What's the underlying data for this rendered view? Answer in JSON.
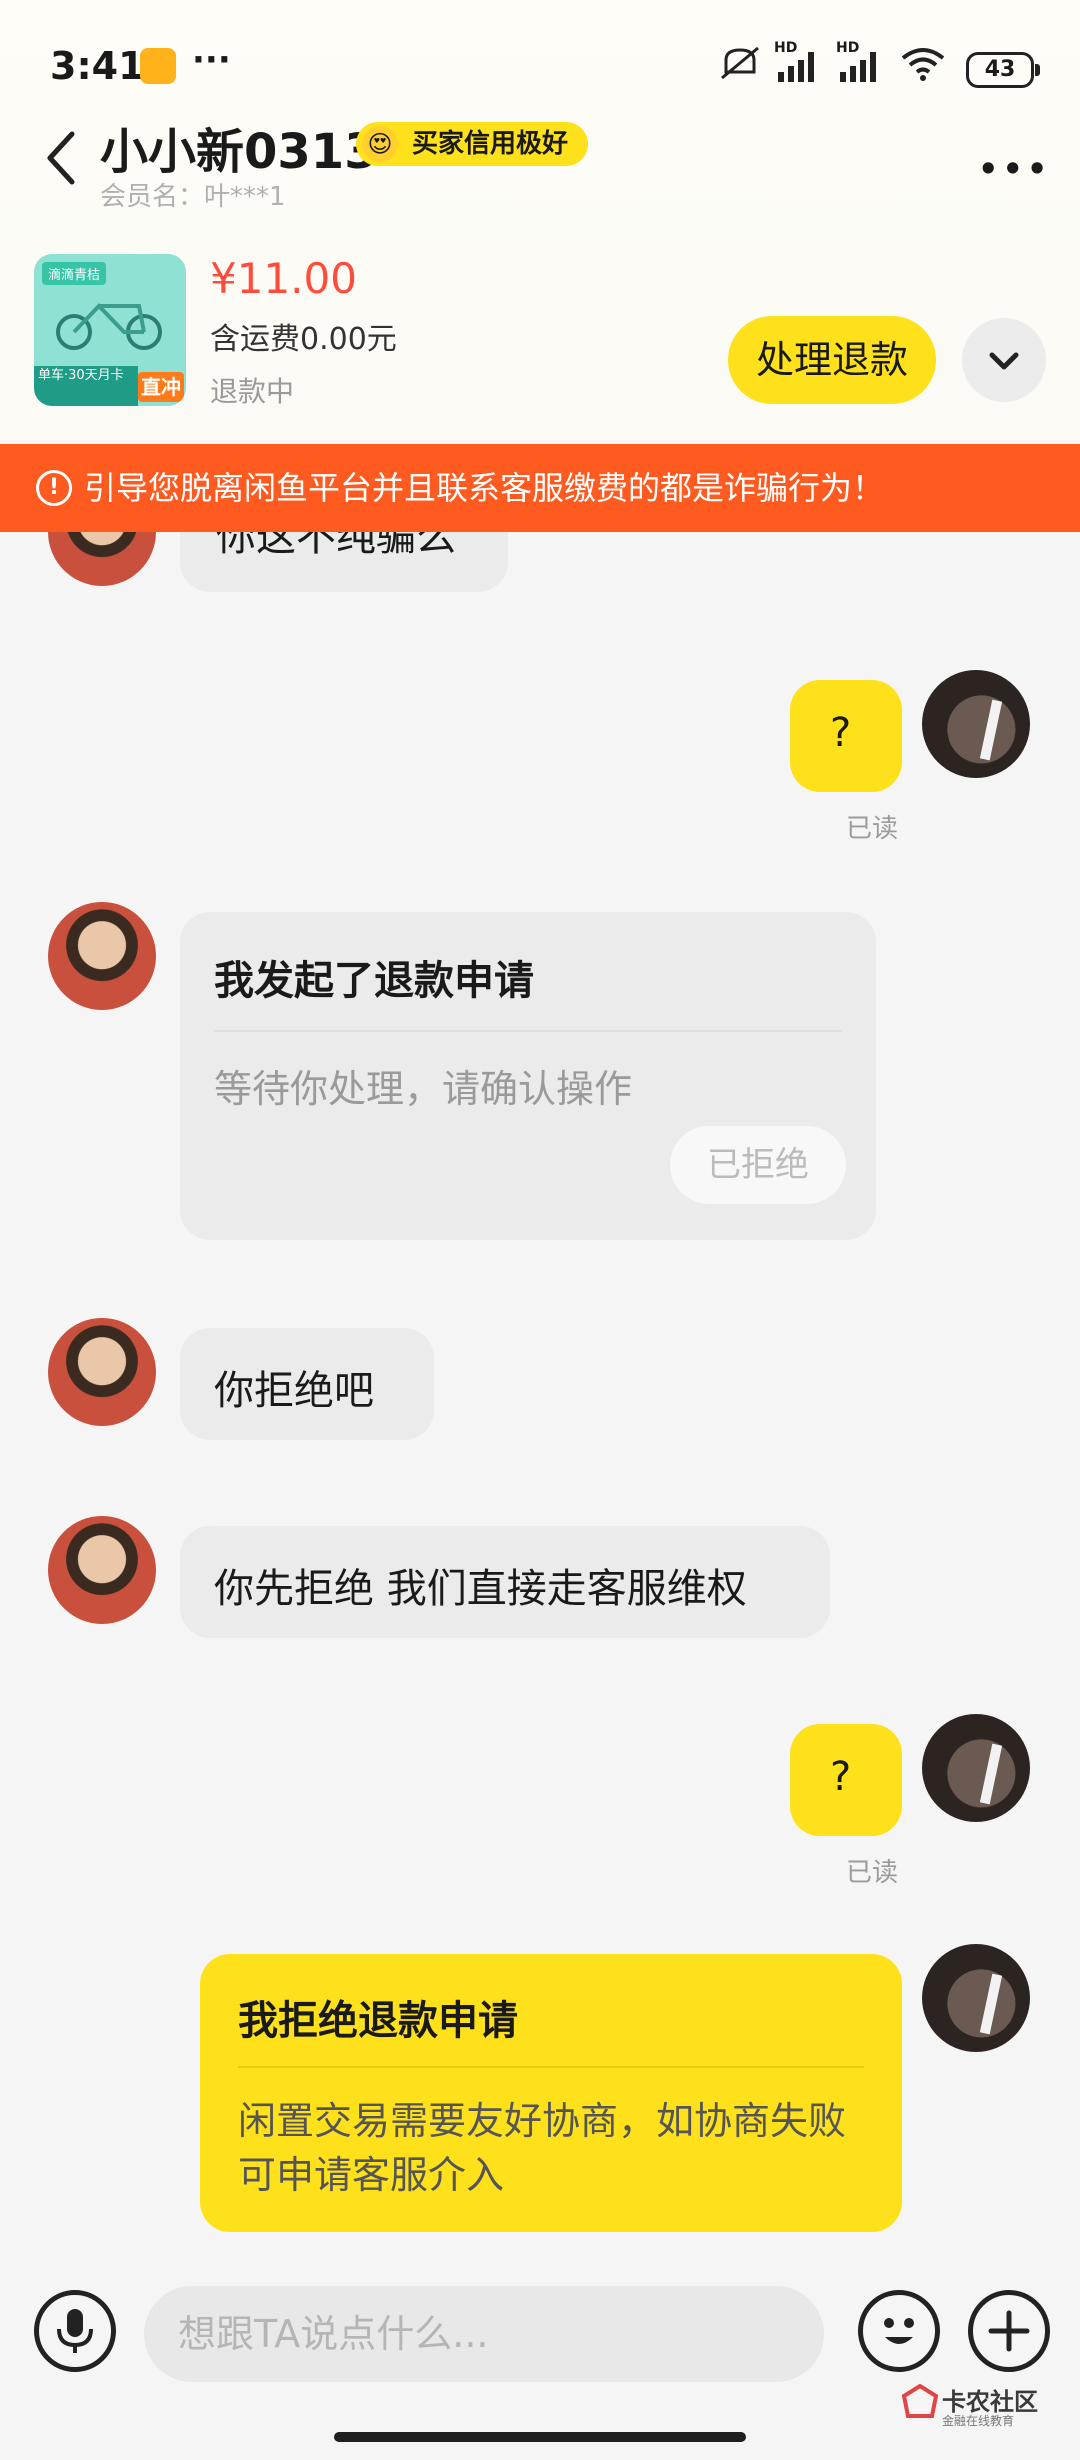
{
  "status_bar": {
    "time": "3:41",
    "more": "···",
    "signal1": "HD",
    "signal2": "HD",
    "battery": "43"
  },
  "header": {
    "back_icon": "chevron-left-icon",
    "title": "小小新0313",
    "badge_emoji": "😍",
    "badge": "买家信用极好",
    "subtitle": "会员名：叶***1",
    "more": "•••"
  },
  "product": {
    "thumb_top": "滴滴青桔",
    "thumb_tag": "单车·30天月卡",
    "thumb_direct": "直冲",
    "price": "¥11.00",
    "shipping": "含运费0.00元",
    "status": "退款中",
    "action_button": "处理退款",
    "expand_icon": "chevron-down-icon"
  },
  "warning": {
    "icon": "!",
    "text": "引导您脱离闲鱼平台并且联系客服缴费的都是诈骗行为！"
  },
  "messages": {
    "m0": "你这不纯骗么",
    "m1": "?",
    "m1_status": "已读",
    "m2_title": "我发起了退款申请",
    "m2_desc": "等待你处理，请确认操作",
    "m2_button": "已拒绝",
    "m3": "你拒绝吧",
    "m4": "你先拒绝 我们直接走客服维权",
    "m5": "?",
    "m5_status": "已读",
    "m6_title": "我拒绝退款申请",
    "m6_desc": "闲置交易需要友好协商，如协商失败可申请客服介入"
  },
  "input": {
    "placeholder": "想跟TA说点什么...",
    "voice_icon": "microphone-icon",
    "emoji_icon": "smiley-icon",
    "plus_icon": "plus-icon"
  },
  "watermark": {
    "name": "卡农社区",
    "sub": "金融在线教育"
  },
  "colors": {
    "accent": "#ffe11b",
    "warning": "#ff5a1f",
    "price": "#ff4c3b"
  }
}
